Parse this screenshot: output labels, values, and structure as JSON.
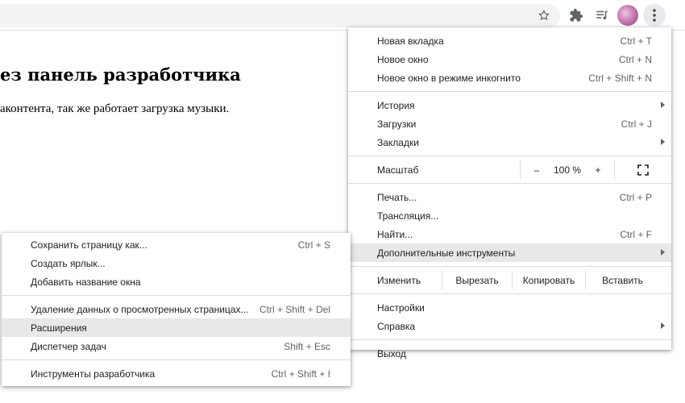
{
  "page": {
    "heading": "ез панель разработчика",
    "text": "аконтента, так же работает загрузка музыки."
  },
  "toolbar": {
    "icons": [
      "star-icon",
      "puzzle-icon",
      "media-queue-icon",
      "avatar",
      "kebab-menu-icon"
    ]
  },
  "main_menu": {
    "new_tab": {
      "label": "Новая вкладка",
      "shortcut": "Ctrl + T"
    },
    "new_window": {
      "label": "Новое окно",
      "shortcut": "Ctrl + N"
    },
    "incognito": {
      "label": "Новое окно в режиме инкогнито",
      "shortcut": "Ctrl + Shift + N"
    },
    "history": {
      "label": "История"
    },
    "downloads": {
      "label": "Загрузки",
      "shortcut": "Ctrl + J"
    },
    "bookmarks": {
      "label": "Закладки"
    },
    "zoom": {
      "label": "Масштаб",
      "minus": "–",
      "value": "100 %",
      "plus": "+"
    },
    "print": {
      "label": "Печать...",
      "shortcut": "Ctrl + P"
    },
    "cast": {
      "label": "Трансляция..."
    },
    "find": {
      "label": "Найти...",
      "shortcut": "Ctrl + F"
    },
    "more_tools": {
      "label": "Дополнительные инструменты"
    },
    "edit": {
      "label": "Изменить",
      "cut": "Вырезать",
      "copy": "Копировать",
      "paste": "Вставить"
    },
    "settings": {
      "label": "Настройки"
    },
    "help": {
      "label": "Справка"
    },
    "exit": {
      "label": "Выход"
    }
  },
  "sub_menu": {
    "save_page": {
      "label": "Сохранить страницу как...",
      "shortcut": "Ctrl + S"
    },
    "create_shortcut": {
      "label": "Создать ярлык..."
    },
    "name_window": {
      "label": "Добавить название окна"
    },
    "clear_data": {
      "label": "Удаление данных о просмотренных страницах...",
      "shortcut": "Ctrl + Shift + Del"
    },
    "extensions": {
      "label": "Расширения"
    },
    "task_manager": {
      "label": "Диспетчер задач",
      "shortcut": "Shift + Esc"
    },
    "dev_tools": {
      "label": "Инструменты разработчика",
      "shortcut": "Ctrl + Shift + I"
    }
  },
  "colors": {
    "highlight": "#e8e8e8",
    "separator": "#dadce0",
    "icon": "#5f6368"
  }
}
